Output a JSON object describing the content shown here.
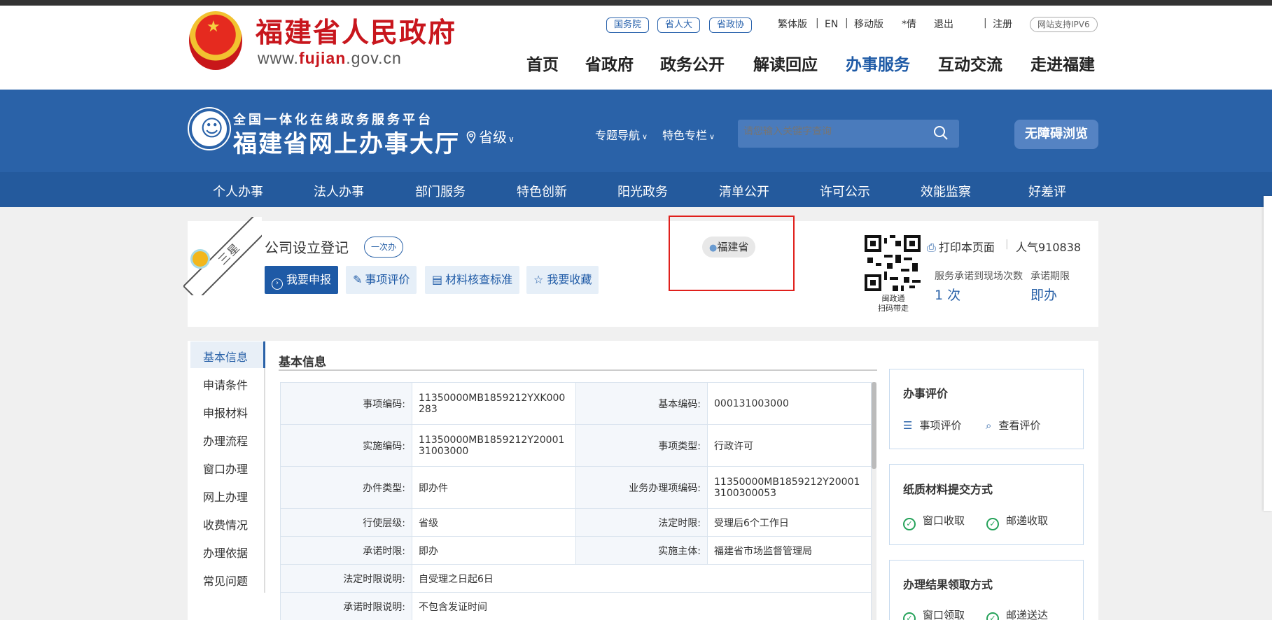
{
  "header": {
    "site_title": "福建省人民政府",
    "site_url_prefix": "www.",
    "site_url_brand": "fujian",
    "site_url_suffix": ".gov.cn",
    "pills": [
      "国务院",
      "省人大",
      "省政协"
    ],
    "top_links": [
      "繁体版",
      "EN",
      "移动版",
      "*倩",
      "退出",
      "注册"
    ],
    "ipv6": "网站支持IPV6",
    "nav": [
      "首页",
      "省政府",
      "政务公开",
      "解读回应",
      "办事服务",
      "互动交流",
      "走进福建"
    ]
  },
  "platform": {
    "subtitle": "全国一体化在线政务服务平台",
    "title": "福建省网上办事大厅",
    "region": "省级",
    "links": [
      "专题导航",
      "特色专栏"
    ],
    "search_placeholder": "请您输入关键字查询",
    "accessibility": "无障碍浏览",
    "subnav": [
      "个人办事",
      "法人办事",
      "部门服务",
      "特色创新",
      "阳光政务",
      "清单公开",
      "许可公示",
      "效能监察",
      "好差评"
    ]
  },
  "item": {
    "ribbon": "三星",
    "title": "公司设立登记",
    "badge": "一次办",
    "actions": [
      "我要申报",
      "事项评价",
      "材料核查标准",
      "我要收藏"
    ],
    "location": "福建省",
    "qr_label_1": "闽政通",
    "qr_label_2": "扫码带走",
    "print": "打印本页面",
    "popularity": "人气910838",
    "visits_label": "服务承诺到现场次数",
    "visits_value": "1 次",
    "deadline_label": "承诺期限",
    "deadline_value": "即办"
  },
  "sidebar": [
    "基本信息",
    "申请条件",
    "申报材料",
    "办理流程",
    "窗口办理",
    "网上办理",
    "收费情况",
    "办理依据",
    "常见问题"
  ],
  "basic": {
    "title": "基本信息",
    "rows": [
      {
        "k1": "事项编码:",
        "v1": "11350000MB1859212YXK000283",
        "k2": "基本编码:",
        "v2": "000131003000"
      },
      {
        "k1": "实施编码:",
        "v1": "11350000MB1859212Y2000131003000",
        "k2": "事项类型:",
        "v2": "行政许可"
      },
      {
        "k1": "办件类型:",
        "v1": "即办件",
        "k2": "业务办理项编码:",
        "v2": "11350000MB1859212Y200013100300053"
      },
      {
        "k1": "行使层级:",
        "v1": "省级",
        "k2": "法定时限:",
        "v2": "受理后6个工作日"
      },
      {
        "k1": "承诺时限:",
        "v1": "即办",
        "k2": "实施主体:",
        "v2": "福建省市场监督管理局"
      }
    ],
    "row_legal_k": "法定时限说明:",
    "row_legal_v": "自受理之日起6日",
    "row_promise_k": "承诺时限说明:",
    "row_promise_v": "不包含发证时间"
  },
  "panels": {
    "eval_title": "办事评价",
    "eval_items": [
      "事项评价",
      "查看评价"
    ],
    "paper_title": "纸质材料提交方式",
    "paper_items": [
      "窗口收取",
      "邮递收取"
    ],
    "result_title": "办理结果领取方式",
    "result_items": [
      "窗口领取",
      "邮递送达"
    ]
  }
}
